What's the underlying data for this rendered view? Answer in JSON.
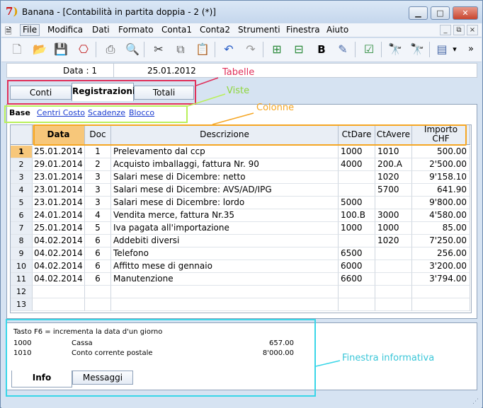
{
  "window": {
    "title": "Banana - [Contabilità in partita doppia - 2 (*)]",
    "btn_min": "▁",
    "btn_max": "□",
    "btn_close": "✕"
  },
  "menu": {
    "items": [
      "File",
      "Modifica",
      "Dati",
      "Formato",
      "Conta1",
      "Conta2",
      "Strumenti",
      "Finestra",
      "Aiuto"
    ],
    "mdi_min": "_",
    "mdi_restore": "⧉",
    "mdi_close": "×"
  },
  "toolbar": {
    "bold": "B",
    "more": "»",
    "dropdown": "▾"
  },
  "infobar": {
    "label": "Data : 1",
    "value": "25.01.2012"
  },
  "tabs": [
    "Conti",
    "Registrazioni",
    "Totali"
  ],
  "views": [
    "Base",
    "Centri Costo",
    "Scadenze",
    "Blocco"
  ],
  "annotations": {
    "tables": "Tabelle",
    "views": "Viste",
    "columns": "Colonne",
    "info": "Finestra informativa"
  },
  "columns": [
    "Data",
    "Doc",
    "Descrizione",
    "CtDare",
    "CtAvere",
    "Importo CHF"
  ],
  "rows": [
    {
      "n": "1",
      "date": "25.01.2014",
      "doc": "1",
      "desc": "Prelevamento dal ccp",
      "dare": "1000",
      "avere": "1010",
      "amount": "500.00"
    },
    {
      "n": "2",
      "date": "29.01.2014",
      "doc": "2",
      "desc": "Acquisto imballaggi, fattura Nr. 90",
      "dare": "4000",
      "avere": "200.A",
      "amount": "2'500.00"
    },
    {
      "n": "3",
      "date": "23.01.2014",
      "doc": "3",
      "desc": "Salari mese di Dicembre: netto",
      "dare": "",
      "avere": "1020",
      "amount": "9'158.10"
    },
    {
      "n": "4",
      "date": "23.01.2014",
      "doc": "3",
      "desc": "Salari mese di Dicembre: AVS/AD/IPG",
      "dare": "",
      "avere": "5700",
      "amount": "641.90"
    },
    {
      "n": "5",
      "date": "23.01.2014",
      "doc": "3",
      "desc": "Salari mese di Dicembre: lordo",
      "dare": "5000",
      "avere": "",
      "amount": "9'800.00"
    },
    {
      "n": "6",
      "date": "24.01.2014",
      "doc": "4",
      "desc": "Vendita merce, fattura Nr.35",
      "dare": "100.B",
      "avere": "3000",
      "amount": "4'580.00"
    },
    {
      "n": "7",
      "date": "25.01.2014",
      "doc": "5",
      "desc": "Iva pagata all'importazione",
      "dare": "1000",
      "avere": "1000",
      "amount": "85.00"
    },
    {
      "n": "8",
      "date": "04.02.2014",
      "doc": "6",
      "desc": "Addebiti diversi",
      "dare": "",
      "avere": "1020",
      "amount": "7'250.00"
    },
    {
      "n": "9",
      "date": "04.02.2014",
      "doc": "6",
      "desc": "Telefono",
      "dare": "6500",
      "avere": "",
      "amount": "256.00"
    },
    {
      "n": "10",
      "date": "04.02.2014",
      "doc": "6",
      "desc": "Affitto mese di gennaio",
      "dare": "6000",
      "avere": "",
      "amount": "3'200.00"
    },
    {
      "n": "11",
      "date": "04.02.2014",
      "doc": "6",
      "desc": "Manutenzione",
      "dare": "6600",
      "avere": "",
      "amount": "3'794.00"
    },
    {
      "n": "12",
      "date": "",
      "doc": "",
      "desc": "",
      "dare": "",
      "avere": "",
      "amount": ""
    },
    {
      "n": "13",
      "date": "",
      "doc": "",
      "desc": "",
      "dare": "",
      "avere": "",
      "amount": ""
    }
  ],
  "info": {
    "hint": "Tasto F6 = incrementa la data d'un giorno",
    "lines": [
      {
        "account": "1000",
        "name": "Cassa",
        "amount": "657.00"
      },
      {
        "account": "1010",
        "name": "Conto corrente postale",
        "amount": "8'000.00"
      }
    ],
    "tabs": [
      "Info",
      "Messaggi"
    ]
  }
}
